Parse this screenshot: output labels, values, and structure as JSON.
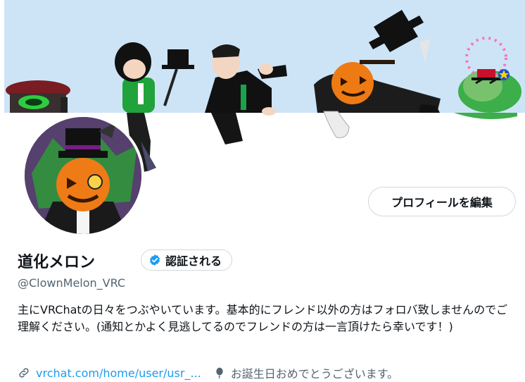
{
  "profile": {
    "display_name": "道化メロン",
    "verify_label": "認証される",
    "handle": "@ClownMelon_VRC",
    "bio": "主にVRChatの日々をつぶやいています。基本的にフレンド以外の方はフォロバ致しませんのでご理解ください。(通知とかよく見逃してるのでフレンドの方は一言頂けたら幸いです！)",
    "website": "vrchat.com/home/user/usr_...",
    "birthday": "お誕生日おめでとうございます。"
  },
  "actions": {
    "edit_profile_label": "プロフィールを編集"
  },
  "icons": {
    "verified": "verified-badge-icon",
    "link": "link-icon",
    "location": "balloon-icon"
  },
  "colors": {
    "accent": "#1d9bf0",
    "banner_sky": "#cde4f7",
    "muted_text": "#536471",
    "border": "#cfd9de"
  }
}
